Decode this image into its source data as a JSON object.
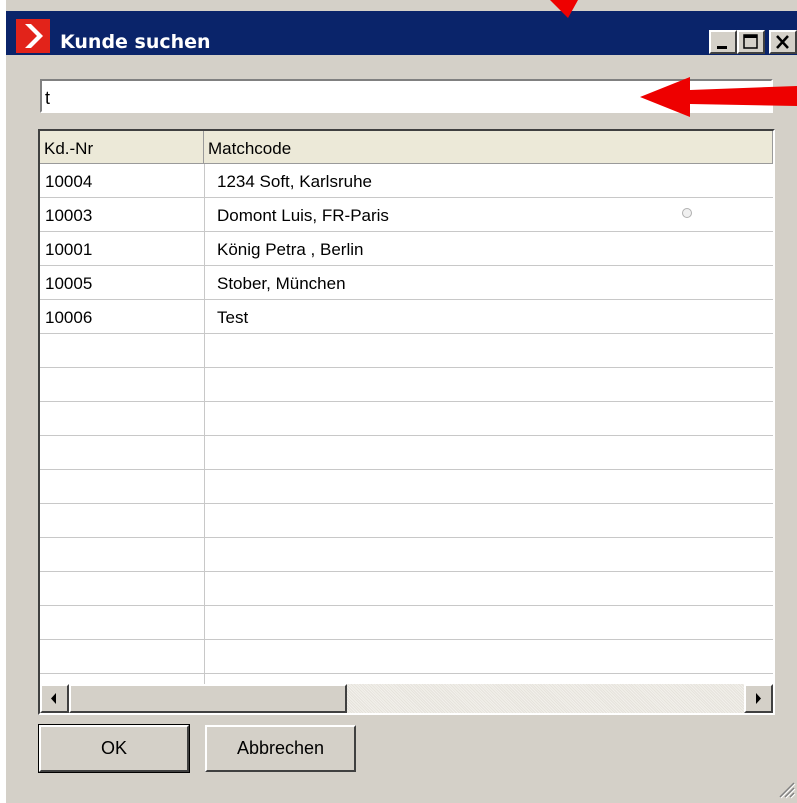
{
  "window": {
    "title": "Kunde suchen",
    "title_bar_color": "#0a246a",
    "logo_color": "#e2231a"
  },
  "search": {
    "value": "t",
    "placeholder": ""
  },
  "table": {
    "columns": [
      "Kd.-Nr",
      "Matchcode"
    ],
    "rows": [
      {
        "kd_nr": "10004",
        "matchcode": "1234 Soft, Karlsruhe"
      },
      {
        "kd_nr": "10003",
        "matchcode": "Domont Luis, FR-Paris"
      },
      {
        "kd_nr": "10001",
        "matchcode": "König Petra , Berlin"
      },
      {
        "kd_nr": "10005",
        "matchcode": "Stober, München"
      },
      {
        "kd_nr": "10006",
        "matchcode": "Test"
      }
    ]
  },
  "buttons": {
    "ok": "OK",
    "cancel": "Abbrechen"
  },
  "annotation": {
    "arrow_color": "#ee0000"
  }
}
